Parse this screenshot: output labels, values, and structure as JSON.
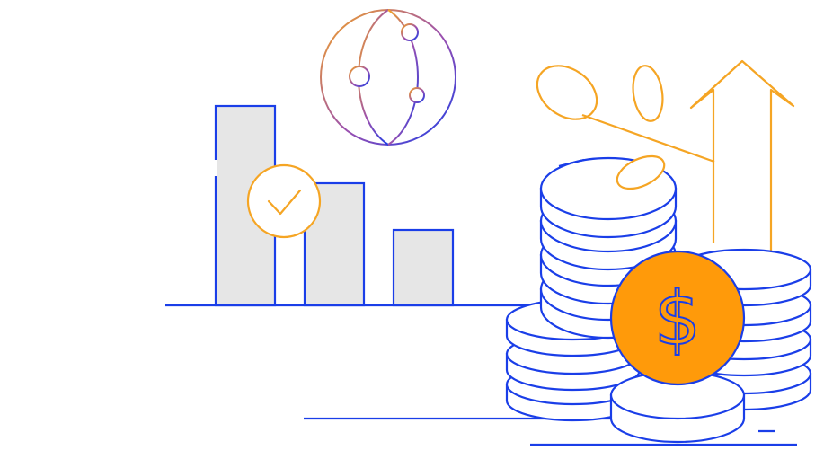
{
  "illustration": {
    "coin_symbol": "$",
    "icons": [
      "globe-network-icon",
      "checkmark-badge-icon",
      "bar-chart-icon",
      "coin-stack-icon",
      "dollar-coin-icon",
      "growth-arrow-icon",
      "sprout-leaves-icon"
    ]
  },
  "colors": {
    "blue": "#1a3ee8",
    "orange": "#f5a524",
    "coin_orange": "#ff9a0a",
    "bar_fill": "#e6e6e6",
    "purple": "#8a4fb4",
    "background": "#ffffff"
  }
}
